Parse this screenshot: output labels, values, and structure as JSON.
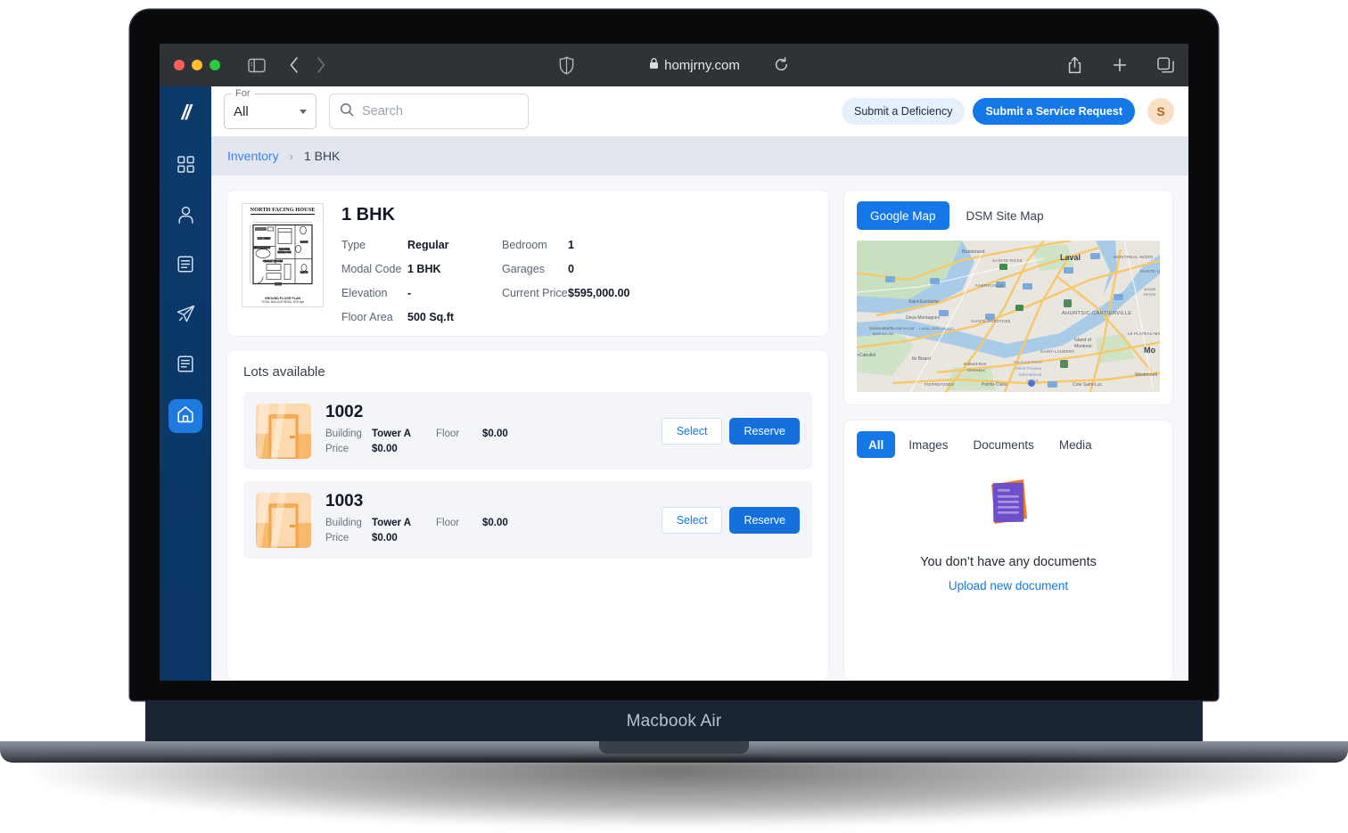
{
  "browser": {
    "url": "homjrny.com",
    "icons": {
      "sidebar_toggle": "sidebar-toggle-icon",
      "back": "nav-back-icon",
      "forward": "nav-forward-icon",
      "shield": "shield-icon",
      "lock": "lock-icon",
      "reload": "reload-icon",
      "share": "share-icon",
      "new_tab": "plus-icon",
      "tabs": "tabs-icon"
    }
  },
  "device": {
    "label": "Macbook Air"
  },
  "sidebar": {
    "logo": "//",
    "items": [
      {
        "name": "dashboard",
        "icon": "grid-icon",
        "active": false
      },
      {
        "name": "contacts",
        "icon": "person-icon",
        "active": false
      },
      {
        "name": "list",
        "icon": "list-icon",
        "active": false
      },
      {
        "name": "send",
        "icon": "paper-plane-icon",
        "active": false
      },
      {
        "name": "documents",
        "icon": "document-icon",
        "active": false
      },
      {
        "name": "home",
        "icon": "home-icon",
        "active": true
      }
    ]
  },
  "topbar": {
    "for_label": "For",
    "for_value": "All",
    "search_placeholder": "Search",
    "search_value": "",
    "deficiency_button": "Submit a Deficiency",
    "service_request_button": "Submit a Service Request",
    "avatar_initial": "S"
  },
  "breadcrumb": {
    "root": "Inventory",
    "separator": "›",
    "current": "1 BHK"
  },
  "property": {
    "title": "1 BHK",
    "floorplan": {
      "title": "NORTH FACING HOUSE",
      "caption1": "GROUND FLOOR PLAN",
      "caption2": "TOTAL BUILDUP AREA ~825 sqft",
      "rooms": [
        "KITCHEN",
        "BREAKFAST",
        "MASTER BEDROOM",
        "BATH",
        "GREAT ROOM",
        "BATH"
      ]
    },
    "specs_left": [
      {
        "label": "Type",
        "value": "Regular"
      },
      {
        "label": "Modal Code",
        "value": "1 BHK"
      },
      {
        "label": "Elevation",
        "value": "-"
      },
      {
        "label": "Floor Area",
        "value": "500 Sq.ft"
      }
    ],
    "specs_right": [
      {
        "label": "Bedroom",
        "value": "1"
      },
      {
        "label": "Garages",
        "value": "0"
      },
      {
        "label": "Current Price",
        "value": "$595,000.00"
      }
    ]
  },
  "lots": {
    "title": "Lots available",
    "meta_labels": {
      "building": "Building",
      "floor": "Floor",
      "price": "Price"
    },
    "select_label": "Select",
    "reserve_label": "Reserve",
    "items": [
      {
        "number": "1002",
        "building": "Tower A",
        "floor": "$0.00",
        "price": "$0.00"
      },
      {
        "number": "1003",
        "building": "Tower A",
        "floor": "$0.00",
        "price": "$0.00"
      }
    ]
  },
  "map": {
    "tabs": [
      {
        "label": "Google Map",
        "active": true
      },
      {
        "label": "DSM Site Map",
        "active": false
      }
    ],
    "place_labels": [
      "Laval",
      "Bois-briand",
      "SAINTE-ROSE",
      "FABREVILLE",
      "Saint-Eustache",
      "Deux-Montagnes",
      "Sainte-Marthe-sur-le-Lac",
      "AHUNTSIC-CARTIERVILLE",
      "MONTREAL-NORD",
      "Island of Montreal",
      "SAINT-LAURENT",
      "Montreal-Pierre Elliott Trudeau International Airport",
      "Dollard-Des Ormeaux",
      "Pointe-Claire",
      "Cote Saint-Luc",
      "Westmount",
      "Mo",
      "PIERREFONDS",
      "Ile Bizard"
    ]
  },
  "documents": {
    "tabs": [
      {
        "label": "All",
        "active": true
      },
      {
        "label": "Images",
        "active": false
      },
      {
        "label": "Documents",
        "active": false
      },
      {
        "label": "Media",
        "active": false
      }
    ],
    "empty_text": "You don’t have any documents",
    "upload_link": "Upload new document"
  },
  "colors": {
    "brand_blue": "#1478e8",
    "sidebar_navy": "#0c3a6b",
    "breadcrumb_bg": "#e2e6ef",
    "page_bg": "#f5f7fa",
    "avatar_bg": "#fbdfc4"
  }
}
